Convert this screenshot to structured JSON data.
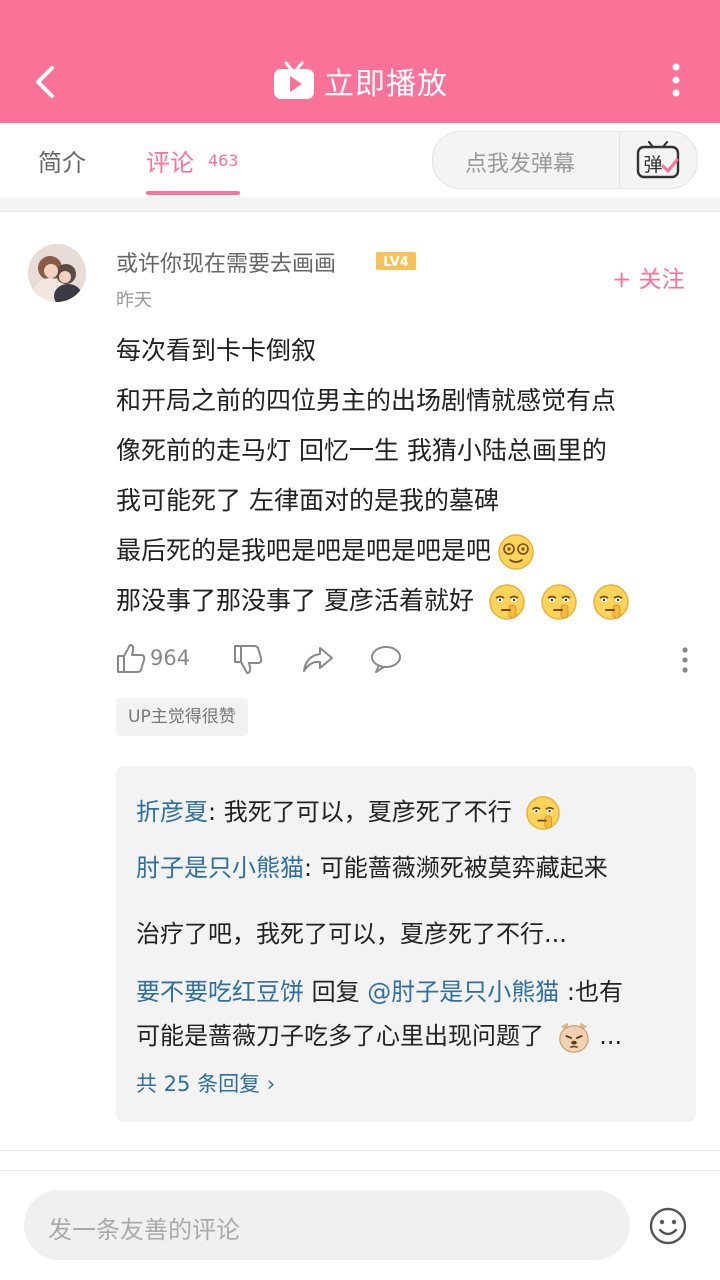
{
  "header": {
    "title": "立即播放"
  },
  "tabs": [
    {
      "label": "简介"
    },
    {
      "label": "评论",
      "count": "463"
    }
  ],
  "danmaku": {
    "placeholder": "点我发弹幕",
    "button_glyph": "弹"
  },
  "comment": {
    "username": "或许你现在需要去画画",
    "level": "LV4",
    "time": "昨天",
    "follow_label": "+ 关注",
    "lines": [
      "每次看到卡卡倒叙",
      "和开局之前的四位男主的出场剧情就感觉有点",
      "像死前的走马灯 回忆一生 我猜小陆总画里的",
      "我可能死了 左律面对的是我的墓碑",
      "最后死的是我吧是吧是吧是吧是吧",
      "那没事了那没事了 夏彦活着就好"
    ],
    "like_count": "964",
    "up_badge": "UP主觉得很赞"
  },
  "replies": [
    {
      "name": "折彦夏",
      "text": ": 我死了可以，夏彦死了不行"
    },
    {
      "name": "肘子是只小熊猫",
      "text": ": 可能蔷薇濒死被莫弈藏起来"
    },
    {
      "name": "",
      "text": "治疗了吧，我死了可以，夏彦死了不行..."
    },
    {
      "name": "要不要吃红豆饼",
      "mid": " 回复 ",
      "mention": "@肘子是只小熊猫",
      "text": " :也有"
    },
    {
      "name": "",
      "text": "可能是蔷薇刀子吃多了心里出现问题了"
    }
  ],
  "reply_ellipsis": " ...",
  "more_replies": "共 25 条回复 ›",
  "input": {
    "placeholder": "发一条友善的评论"
  },
  "colors": {
    "brand_pink": "#fb7299",
    "link_blue": "#2f6f9f"
  }
}
